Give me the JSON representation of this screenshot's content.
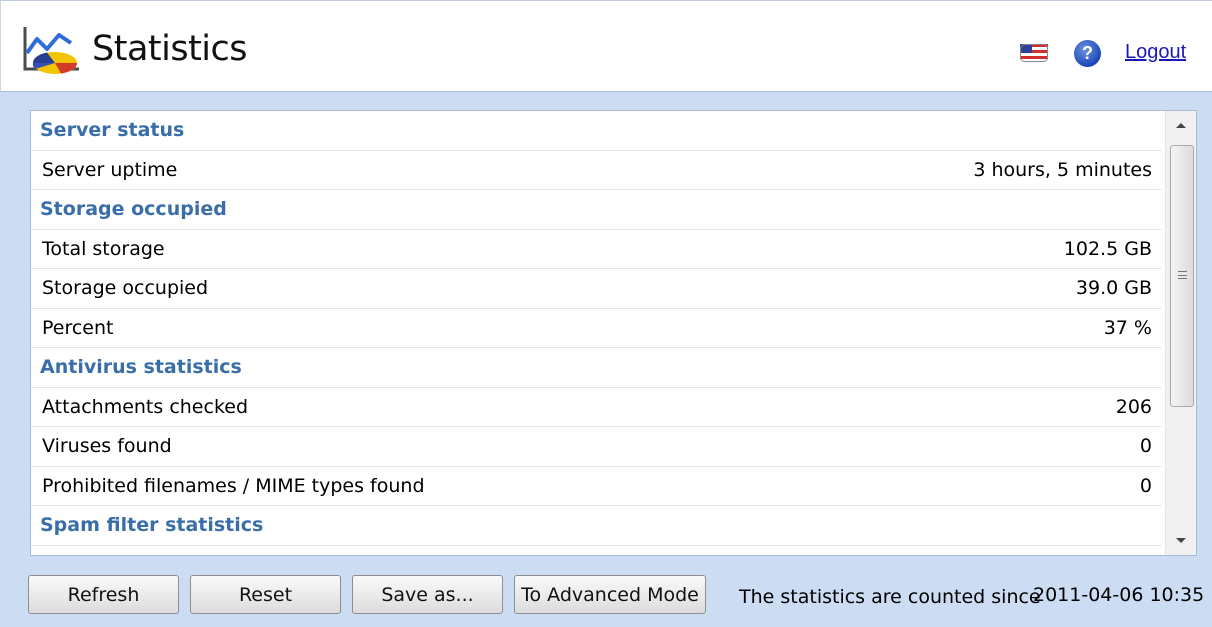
{
  "header": {
    "title": "Statistics",
    "logout_label": "Logout",
    "help_glyph": "?",
    "icons": {
      "logo": "statistics-chart-icon",
      "flag": "us-flag-icon",
      "help": "help-icon"
    }
  },
  "sections": [
    {
      "title": "Server status",
      "rows": [
        {
          "label": "Server uptime",
          "value": "3 hours, 5 minutes"
        }
      ]
    },
    {
      "title": "Storage occupied",
      "rows": [
        {
          "label": "Total storage",
          "value": "102.5 GB"
        },
        {
          "label": "Storage occupied",
          "value": "39.0 GB"
        },
        {
          "label": "Percent",
          "value": "37 %"
        }
      ]
    },
    {
      "title": "Antivirus statistics",
      "rows": [
        {
          "label": "Attachments checked",
          "value": "206"
        },
        {
          "label": "Viruses found",
          "value": "0"
        },
        {
          "label": "Prohibited filenames / MIME types found",
          "value": "0"
        }
      ]
    },
    {
      "title": "Spam filter statistics",
      "rows": []
    }
  ],
  "footer": {
    "buttons": {
      "refresh": "Refresh",
      "reset": "Reset",
      "save_as": "Save as...",
      "advanced": "To Advanced Mode"
    },
    "since_label": "The statistics are counted since",
    "since_date": "2011-04-06 10:35"
  },
  "colors": {
    "section_title": "#3a6ea8",
    "content_background": "#cbdcf3",
    "link": "#1a1ab8"
  }
}
